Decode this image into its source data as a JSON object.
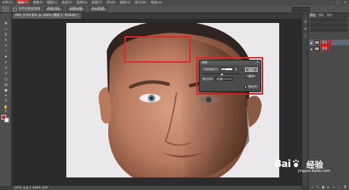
{
  "menubar": {
    "items": [
      "文件(F)",
      "编辑(E)",
      "图像(I)",
      "图层(L)",
      "类型(Y)",
      "选择(S)",
      "滤镜(T)",
      "3D(D)",
      "视图(V)",
      "窗口(W)",
      "帮助(H)"
    ],
    "highlighted_index": 1,
    "window_controls": [
      "–",
      "□",
      "✕"
    ]
  },
  "options_bar": {
    "sample_all_layers": "对所有图层取样",
    "content_aware": "内容识别",
    "create_texture": "创建纹理",
    "proximity_match": "近似匹配"
  },
  "document_tab": "IMG_9795.JPG @ 100% (图层 1, RGB/8) *",
  "dialog": {
    "title": "渐隐",
    "close": "×",
    "opacity_label": "不透明度(O):",
    "opacity_value": "52",
    "opacity_unit": "%",
    "mode_label": "模式(M):",
    "mode_value": "正常",
    "ok": "确定",
    "cancel": "复位",
    "preview": "预览(P)",
    "preview_checked": "✓"
  },
  "status": "100%   文档:3.18M/6.36M",
  "panels": {
    "tabs": [
      "图层",
      "通道",
      "路径"
    ],
    "layers": [
      {
        "name": "图层 1",
        "active": true
      },
      {
        "name": "背景",
        "active": false
      }
    ],
    "footer_icons": [
      "link-icon",
      "fx-icon",
      "mask-icon",
      "adjust-icon",
      "folder-icon",
      "new-layer-icon",
      "trash-icon"
    ]
  },
  "watermark": {
    "logo": "Bai",
    "logo_tail": "百",
    "text": "经验",
    "url": "jingyan.baidu.com"
  },
  "colors": {
    "highlight": "#e0262a",
    "foreground": "#c8191f",
    "background": "#ffffff"
  }
}
